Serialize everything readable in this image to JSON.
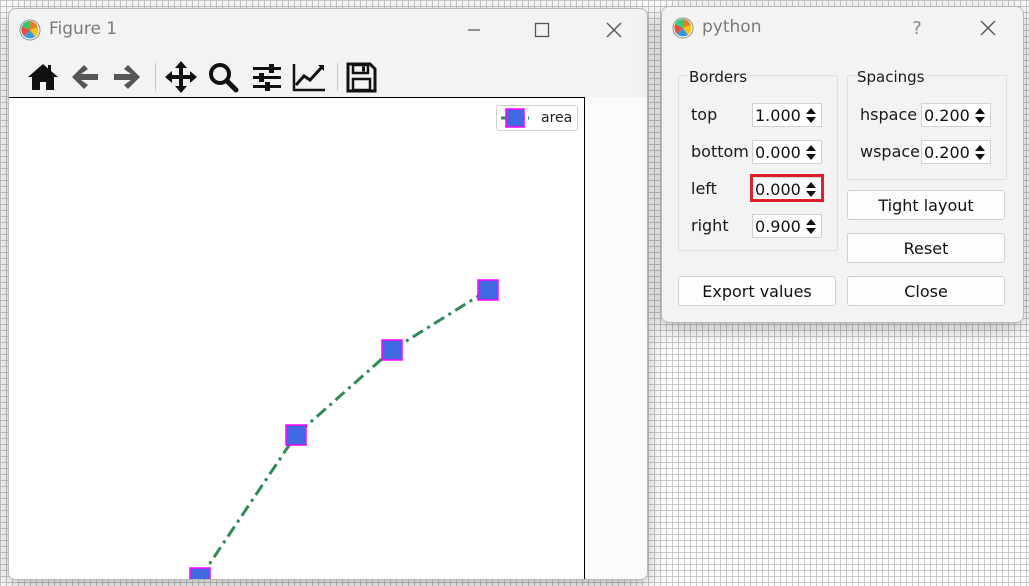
{
  "figure_window": {
    "title": "Figure 1",
    "toolbar": [
      "home-icon",
      "back-arrow-icon",
      "forward-arrow-icon",
      "pan-icon",
      "zoom-icon",
      "configure-subplots-icon",
      "edit-axis-icon",
      "save-icon"
    ],
    "legend_label": "area"
  },
  "dialog": {
    "title": "python",
    "help_label": "?",
    "borders": {
      "title": "Borders",
      "rows": [
        {
          "label": "top",
          "value": "1.000"
        },
        {
          "label": "bottom",
          "value": "0.000"
        },
        {
          "label": "left",
          "value": "0.000"
        },
        {
          "label": "right",
          "value": "0.900"
        }
      ]
    },
    "spacings": {
      "title": "Spacings",
      "rows": [
        {
          "label": "hspace",
          "value": "0.200"
        },
        {
          "label": "wspace",
          "value": "0.200"
        }
      ]
    },
    "buttons": {
      "tight_layout": "Tight layout",
      "reset": "Reset",
      "export": "Export values",
      "close": "Close"
    },
    "highlighted_field": "left"
  },
  "colors": {
    "line": "#2e8b57",
    "marker_fill": "#4169e1",
    "marker_edge": "#ff00ff",
    "highlight": "#e0202a"
  }
}
